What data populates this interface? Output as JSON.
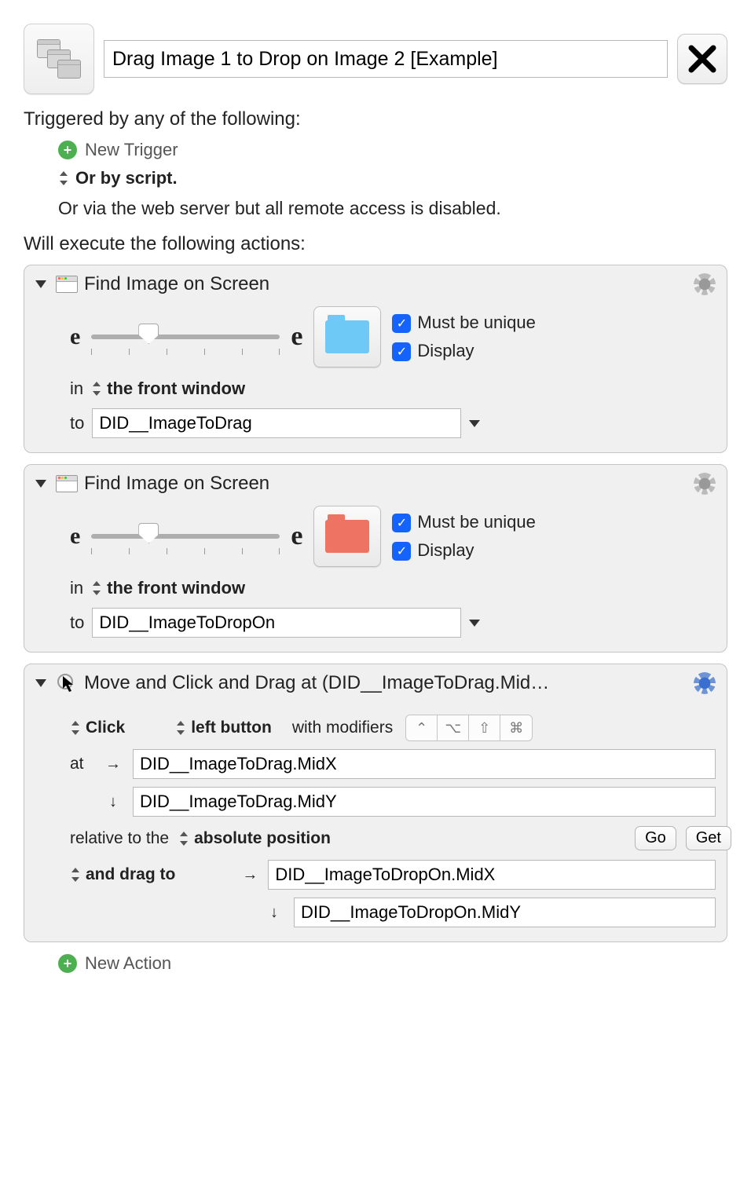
{
  "header": {
    "title": "Drag Image 1 to Drop on Image 2 [Example]"
  },
  "triggers": {
    "heading": "Triggered by any of the following:",
    "new_trigger": "New Trigger",
    "or_script": "Or by script.",
    "remote": "Or via the web server but all remote access is disabled."
  },
  "actions_heading": "Will execute the following actions:",
  "actions": [
    {
      "title": "Find Image on Screen",
      "folder_color": "blue",
      "unique_label": "Must be unique",
      "display_label": "Display",
      "in_label": "in",
      "scope": "the front window",
      "to_label": "to",
      "variable": "DID__ImageToDrag"
    },
    {
      "title": "Find Image on Screen",
      "folder_color": "red",
      "unique_label": "Must be unique",
      "display_label": "Display",
      "in_label": "in",
      "scope": "the front window",
      "to_label": "to",
      "variable": "DID__ImageToDropOn"
    }
  ],
  "move_action": {
    "title": "Move and Click and Drag at (DID__ImageToDrag.Mid…",
    "click_label": "Click",
    "button_label": "left button",
    "modifiers_label": "with modifiers",
    "mods": {
      "ctrl": "⌃",
      "opt": "⌥",
      "shift": "⇧",
      "cmd": "⌘"
    },
    "at_label": "at",
    "x": "DID__ImageToDrag.MidX",
    "y": "DID__ImageToDrag.MidY",
    "relative_label": "relative to the",
    "position": "absolute position",
    "go": "Go",
    "get": "Get",
    "drag_label": "and drag to",
    "dx": "DID__ImageToDropOn.MidX",
    "dy": "DID__ImageToDropOn.MidY"
  },
  "new_action": "New Action"
}
